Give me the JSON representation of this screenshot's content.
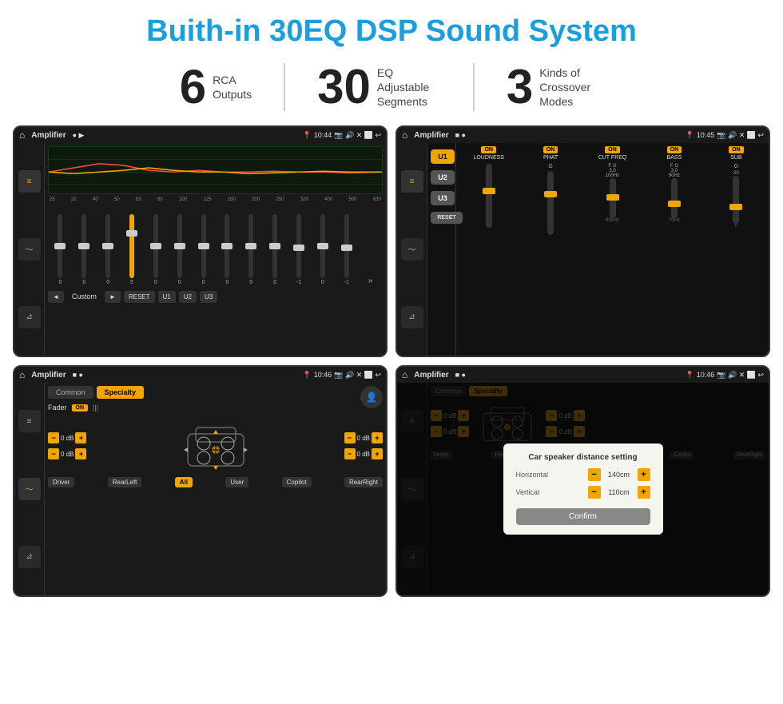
{
  "page": {
    "title": "Buith-in 30EQ DSP Sound System"
  },
  "stats": [
    {
      "number": "6",
      "label_line1": "RCA",
      "label_line2": "Outputs"
    },
    {
      "number": "30",
      "label_line1": "EQ Adjustable",
      "label_line2": "Segments"
    },
    {
      "number": "3",
      "label_line1": "Kinds of",
      "label_line2": "Crossover Modes"
    }
  ],
  "screen1": {
    "app": "Amplifier",
    "time": "10:44",
    "preset": "Custom",
    "freq_labels": [
      "25",
      "32",
      "40",
      "50",
      "63",
      "80",
      "100",
      "125",
      "160",
      "200",
      "250",
      "320",
      "400",
      "500",
      "630"
    ],
    "values": [
      "0",
      "0",
      "0",
      "5",
      "0",
      "0",
      "0",
      "0",
      "0",
      "0",
      "-1",
      "0",
      "-1"
    ],
    "buttons": [
      "◄",
      "Custom",
      "►",
      "RESET",
      "U1",
      "U2",
      "U3"
    ]
  },
  "screen2": {
    "app": "Amplifier",
    "time": "10:45",
    "u_buttons": [
      "U1",
      "U2",
      "U3"
    ],
    "channels": [
      "LOUDNESS",
      "PHAT",
      "CUT FREQ",
      "BASS",
      "SUB"
    ],
    "on_states": [
      true,
      true,
      true,
      true,
      true
    ],
    "reset_label": "RESET"
  },
  "screen3": {
    "app": "Amplifier",
    "time": "10:46",
    "tabs": [
      "Common",
      "Specialty"
    ],
    "active_tab": 1,
    "fader_label": "Fader",
    "on_label": "ON",
    "speaker_positions": [
      "Driver",
      "Copilot",
      "RearLeft",
      "All",
      "User",
      "RearRight"
    ],
    "db_values": [
      "0 dB",
      "0 dB",
      "0 dB",
      "0 dB"
    ],
    "icon_label": "🔒"
  },
  "screen4": {
    "app": "Amplifier",
    "time": "10:46",
    "tabs": [
      "Common",
      "Specialty"
    ],
    "dialog": {
      "title": "Car speaker distance setting",
      "horizontal_label": "Horizontal",
      "horizontal_value": "140cm",
      "vertical_label": "Vertical",
      "vertical_value": "110cm",
      "confirm_label": "Confirm"
    },
    "db_values": [
      "0 dB",
      "0 dB"
    ],
    "bottom_labels": [
      "Driver",
      "RearLeft",
      "All",
      "User",
      "Copilot",
      "RearRight"
    ]
  }
}
